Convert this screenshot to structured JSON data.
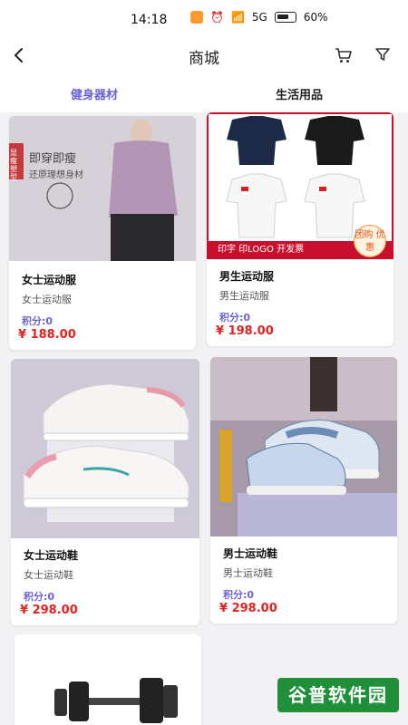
{
  "status": {
    "time": "14:18",
    "network": "5G",
    "battery": "60%"
  },
  "nav": {
    "title": "商城"
  },
  "tabs": [
    {
      "label": "健身器材",
      "active": true
    },
    {
      "label": "生活用品",
      "active": false
    }
  ],
  "products": [
    {
      "title": "女士运动服",
      "subtitle": "女士运动服",
      "points_label": "积分:0",
      "price": "¥ 188.00",
      "image_text": [
        "即穿即瘦",
        "还原理想身材",
        "显瘦塑型"
      ]
    },
    {
      "title": "男生运动服",
      "subtitle": "男生运动服",
      "points_label": "积分:0",
      "price": "¥ 198.00",
      "image_text": [
        "印字 印LOGO 开发票",
        "团购 优惠"
      ]
    },
    {
      "title": "女士运动鞋",
      "subtitle": "女士运动鞋",
      "points_label": "积分:0",
      "price": "¥ 298.00"
    },
    {
      "title": "男士运动鞋",
      "subtitle": "男士运动鞋",
      "points_label": "积分:0",
      "price": "¥ 298.00"
    }
  ],
  "watermark": {
    "text": "谷普软件园"
  },
  "colors": {
    "accent": "#6a63d8",
    "price": "#e0231f",
    "banner": "#c8102e"
  }
}
